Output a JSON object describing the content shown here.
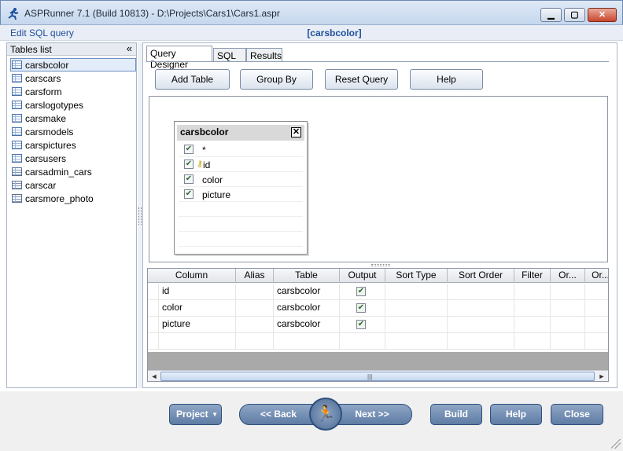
{
  "window": {
    "title": "ASPRunner 7.1 (Build 10813) - D:\\Projects\\Cars1\\Cars1.aspr",
    "minimize_glyph": "▁",
    "maximize_glyph": "▢",
    "close_glyph": "✕"
  },
  "header": {
    "edit_sql_label": "Edit SQL query",
    "current_table": "[carsbcolor]"
  },
  "tables_panel": {
    "title": "Tables list",
    "collapse_glyph": "«",
    "items": [
      {
        "label": "carsbcolor",
        "kind": "table",
        "selected": true
      },
      {
        "label": "carscars",
        "kind": "table"
      },
      {
        "label": "carsform",
        "kind": "table"
      },
      {
        "label": "carslogotypes",
        "kind": "table"
      },
      {
        "label": "carsmake",
        "kind": "table"
      },
      {
        "label": "carsmodels",
        "kind": "table"
      },
      {
        "label": "carspictures",
        "kind": "table"
      },
      {
        "label": "carsusers",
        "kind": "table"
      },
      {
        "label": "carsadmin_cars",
        "kind": "view"
      },
      {
        "label": "carscar",
        "kind": "view"
      },
      {
        "label": "carsmore_photo",
        "kind": "view"
      }
    ]
  },
  "tabs": [
    {
      "label": "Query Designer",
      "active": true
    },
    {
      "label": "SQL"
    },
    {
      "label": "Results"
    }
  ],
  "toolbar": {
    "add_table": "Add Table",
    "group_by": "Group By",
    "reset_query": "Reset Query",
    "help": "Help"
  },
  "table_box": {
    "title": "carsbcolor",
    "close_glyph": "✕",
    "fields": [
      {
        "name": "*",
        "checked": true,
        "key": false
      },
      {
        "name": "id",
        "checked": true,
        "key": true
      },
      {
        "name": "color",
        "checked": true,
        "key": false
      },
      {
        "name": "picture",
        "checked": true,
        "key": false
      }
    ]
  },
  "grid": {
    "columns": [
      "Column",
      "Alias",
      "Table",
      "Output",
      "Sort Type",
      "Sort Order",
      "Filter",
      "Or...",
      "Or..."
    ],
    "rows": [
      {
        "column": "id",
        "alias": "",
        "table": "carsbcolor",
        "output": true
      },
      {
        "column": "color",
        "alias": "",
        "table": "carsbcolor",
        "output": true
      },
      {
        "column": "picture",
        "alias": "",
        "table": "carsbcolor",
        "output": true
      }
    ],
    "scroll_left_glyph": "◄",
    "scroll_right_glyph": "►",
    "scroll_grip_glyph": "|||"
  },
  "bottom_bar": {
    "project": "Project",
    "back": "<< Back",
    "next": "Next >>",
    "build": "Build",
    "help": "Help",
    "close": "Close",
    "run_glyph": "🏃"
  },
  "colors": {
    "accent": "#1f4f9c",
    "nav_button": "#6f8bb1"
  }
}
